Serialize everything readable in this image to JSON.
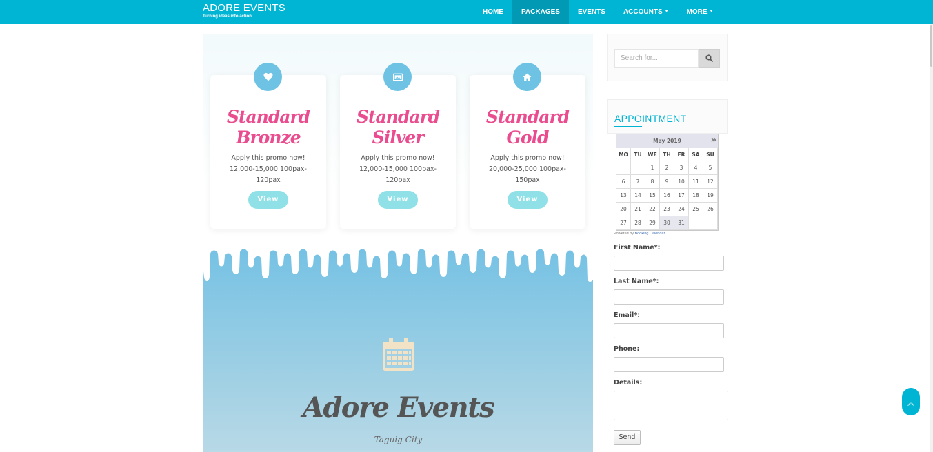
{
  "brand": {
    "title": "ADORE EVENTS",
    "tagline": "Turning ideas into action"
  },
  "nav": {
    "items": [
      {
        "label": "HOME",
        "active": false,
        "dropdown": false
      },
      {
        "label": "PACKAGES",
        "active": true,
        "dropdown": false
      },
      {
        "label": "EVENTS",
        "active": false,
        "dropdown": false
      },
      {
        "label": "ACCOUNTS",
        "active": false,
        "dropdown": true
      },
      {
        "label": "MORE",
        "active": false,
        "dropdown": true
      }
    ]
  },
  "packages": [
    {
      "title_line1": "Standard",
      "title_line2": "Bronze",
      "description": "Apply this promo now! 12,000-15,000 100pax-120pax",
      "button": "View",
      "icon": "heart-icon"
    },
    {
      "title_line1": "Standard",
      "title_line2": "Silver",
      "description": "Apply this promo now! 12,000-15,000 100pax-120pax",
      "button": "View",
      "icon": "picture-icon"
    },
    {
      "title_line1": "Standard",
      "title_line2": "Gold",
      "description": "Apply this promo now! 20,000-25,000 100pax-150pax",
      "button": "View",
      "icon": "home-icon"
    }
  ],
  "events_banner": {
    "title": "Adore Events",
    "subtitle": "Taguig City",
    "icon": "calendar-icon"
  },
  "search": {
    "placeholder": "Search for...",
    "icon": "search-icon"
  },
  "appointment": {
    "title": "APPOINTMENT",
    "calendar": {
      "month": "May 2019",
      "next": "»",
      "weekdays": [
        "MO",
        "TU",
        "WE",
        "TH",
        "FR",
        "SA",
        "SU"
      ],
      "days": [
        "",
        "",
        "1",
        "2",
        "3",
        "4",
        "5",
        "6",
        "7",
        "8",
        "9",
        "10",
        "11",
        "12",
        "13",
        "14",
        "15",
        "16",
        "17",
        "18",
        "19",
        "20",
        "21",
        "22",
        "23",
        "24",
        "25",
        "26",
        "27",
        "28",
        "29",
        "30",
        "31",
        "",
        ""
      ],
      "highlighted": [
        "30",
        "31"
      ]
    },
    "powered_by": "Powered by",
    "powered_link": "Booking Calendar"
  },
  "form": {
    "first_name_label": "First Name*:",
    "last_name_label": "Last Name*:",
    "email_label": "Email*:",
    "phone_label": "Phone:",
    "details_label": "Details:",
    "send_label": "Send"
  },
  "colors": {
    "navbar": "#00b4d3",
    "nav_active": "#0199b4",
    "title_pink": "#ea4d8f",
    "icon_blue": "#6ec2e3",
    "view_button": "#8fe1e7",
    "banner_blue": "#74c1e4"
  }
}
